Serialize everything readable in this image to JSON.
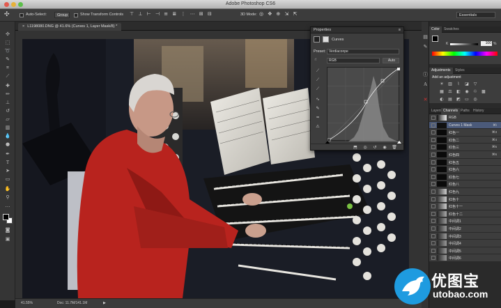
{
  "window": {
    "title": "Adobe Photoshop CS6"
  },
  "options_bar": {
    "auto_select_label": "Auto-Select:",
    "auto_select_value": "Group",
    "transform_label": "Show Transform Controls",
    "mode_3d": "3D Mode:",
    "workspace": "Essentials"
  },
  "document": {
    "tab_label": "L1198080.DNG @ 41.6% (Curves 1, Layer Mask/8) *",
    "zoom": "41.55%",
    "doc_info": "Doc: 11.7M/141.1M"
  },
  "properties": {
    "panel_title": "Properties",
    "adjustment_name": "Curves",
    "preset_label": "Preset:",
    "preset_value": "Verdiaconpe",
    "channel_value": "RGB",
    "auto_label": "Auto"
  },
  "color_panel": {
    "tabs": [
      "Color",
      "Swatches"
    ],
    "k_label": "K",
    "k_value": "100",
    "percent": "%"
  },
  "adjustments_panel": {
    "tabs": [
      "Adjustments",
      "Styles"
    ],
    "add_label": "Add an adjustment"
  },
  "channels_panel": {
    "tabs": [
      "Layers",
      "Channels",
      "Paths",
      "History"
    ],
    "rows": [
      {
        "name": "RGB",
        "key": ""
      },
      {
        "name": "Curves 1 Mask",
        "key": "⌘\\"
      },
      {
        "name": "红色一",
        "key": "⌘3"
      },
      {
        "name": "红色二",
        "key": "⌘4"
      },
      {
        "name": "红色三",
        "key": "⌘5"
      },
      {
        "name": "红色四",
        "key": "⌘6"
      },
      {
        "name": "红色五",
        "key": ""
      },
      {
        "name": "红色六",
        "key": ""
      },
      {
        "name": "红色七",
        "key": ""
      },
      {
        "name": "红色八",
        "key": ""
      },
      {
        "name": "红色九",
        "key": ""
      },
      {
        "name": "红色十",
        "key": ""
      },
      {
        "name": "红色十一",
        "key": ""
      },
      {
        "name": "红色十二",
        "key": ""
      },
      {
        "name": "中间调1",
        "key": ""
      },
      {
        "name": "中间调2",
        "key": ""
      },
      {
        "name": "中间调3",
        "key": ""
      },
      {
        "name": "中间调4",
        "key": ""
      },
      {
        "name": "中间调5",
        "key": ""
      },
      {
        "name": "中间调6",
        "key": ""
      }
    ]
  },
  "watermark": {
    "brand": "优图宝",
    "url": "utobao.com"
  },
  "colors": {
    "sweater": "#b8231e",
    "panel_bg": "#3d3d3d",
    "selected_row": "#4b5a7a",
    "watermark_bird": "#1e9be0"
  }
}
